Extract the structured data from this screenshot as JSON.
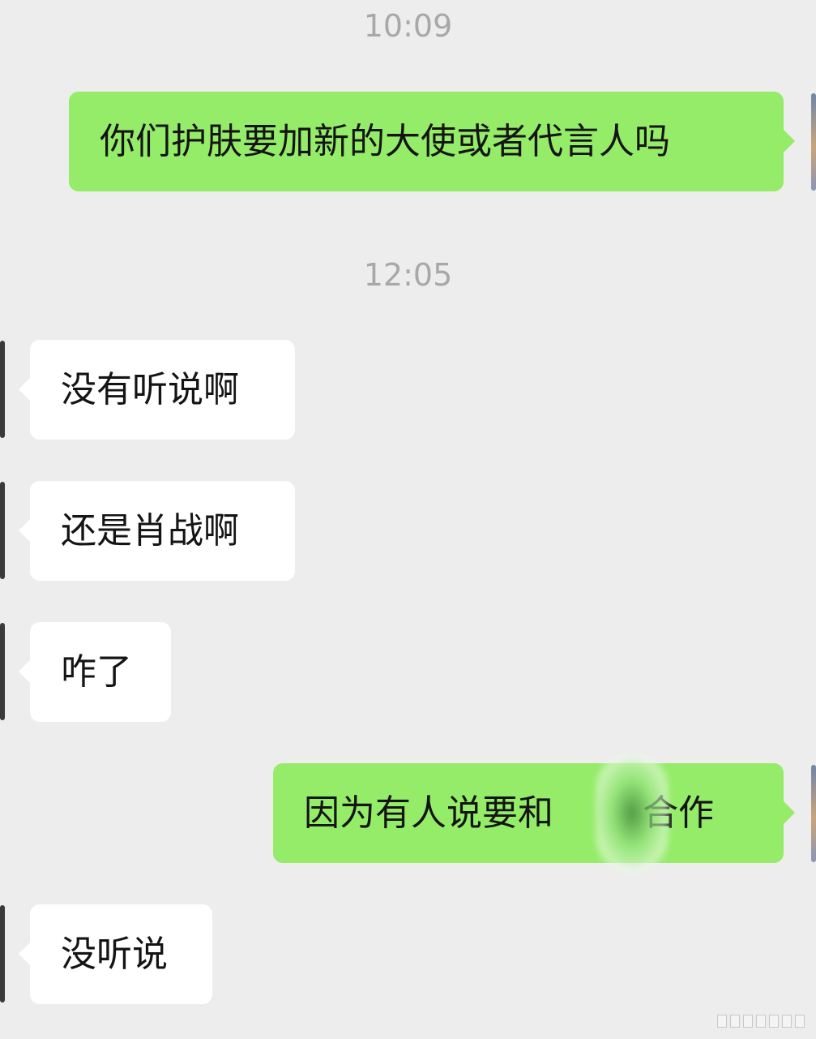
{
  "timestamps": [
    "10:09",
    "12:05"
  ],
  "messages": [
    {
      "side": "out",
      "text": "你们护肤要加新的大使或者代言人吗"
    },
    {
      "side": "in",
      "text": "没有听说啊"
    },
    {
      "side": "in",
      "text": "还是肖战啊"
    },
    {
      "side": "in",
      "text": "咋了"
    },
    {
      "side": "out",
      "text": "因为有人说要和",
      "text_after_redaction": "合作"
    },
    {
      "side": "in",
      "text": "没听说"
    }
  ],
  "colors": {
    "background": "#ededed",
    "outgoing_bubble": "#95ec69",
    "incoming_bubble": "#ffffff",
    "timestamp": "#a8a8a8"
  }
}
